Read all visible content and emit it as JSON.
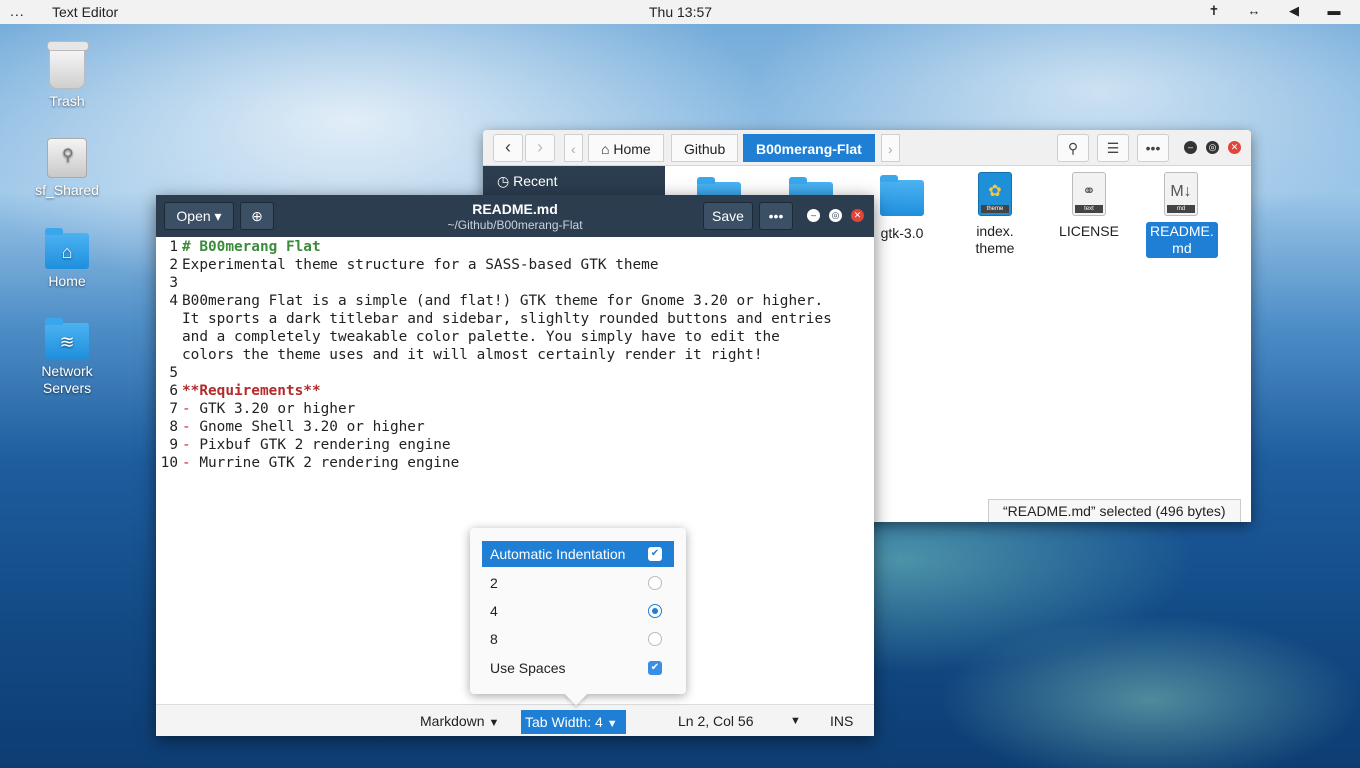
{
  "topbar": {
    "activities": "...",
    "app_name": "Text Editor",
    "clock": "Thu 13:57",
    "tray_icons": [
      "accessibility-icon",
      "network-icon",
      "volume-icon",
      "battery-icon"
    ]
  },
  "desktop": {
    "icons": [
      {
        "label": "Trash",
        "icon": "trash-icon"
      },
      {
        "label": "sf_Shared",
        "icon": "drive-icon"
      },
      {
        "label": "Home",
        "icon": "home-folder-icon"
      },
      {
        "label": "Network Servers",
        "icon": "network-folder-icon"
      }
    ]
  },
  "file_manager": {
    "breadcrumbs": [
      "Home",
      "Github",
      "B00merang-Flat"
    ],
    "active_crumb": "B00merang-Flat",
    "sidebar": {
      "recent": "Recent"
    },
    "files": [
      {
        "label": "gtk-3.0",
        "type": "folder"
      },
      {
        "label": "index.\ntheme",
        "type": "theme",
        "tag": "theme"
      },
      {
        "label": "LICENSE",
        "type": "text",
        "tag": "text"
      },
      {
        "label": "README.\nmd",
        "type": "markdown",
        "tag": "md",
        "selected": true
      }
    ],
    "status": "“README.md” selected  (496 bytes)"
  },
  "editor": {
    "open_label": "Open",
    "title": "README.md",
    "subtitle": "~/Github/B00merang-Flat",
    "save_label": "Save",
    "lines": [
      {
        "n": "1",
        "text": "# B00merang Flat"
      },
      {
        "n": "2",
        "text": "Experimental theme structure for a SASS-based GTK theme"
      },
      {
        "n": "3",
        "text": ""
      },
      {
        "n": "4",
        "text": "B00merang Flat is a simple (and flat!) GTK theme for Gnome 3.20 or higher."
      },
      {
        "n": "",
        "text": "It sports a dark titlebar and sidebar, slighlty rounded buttons and entries"
      },
      {
        "n": "",
        "text": "and a completely tweakable color palette. You simply have to edit the"
      },
      {
        "n": "",
        "text": "colors the theme uses and it will almost certainly render it right!"
      },
      {
        "n": "5",
        "text": ""
      },
      {
        "n": "6",
        "text": "**Requirements**"
      },
      {
        "n": "7",
        "text": "GTK 3.20 or higher"
      },
      {
        "n": "8",
        "text": "Gnome Shell 3.20 or higher"
      },
      {
        "n": "9",
        "text": "Pixbuf GTK 2 rendering engine"
      },
      {
        "n": "10",
        "text": "Murrine GTK 2 rendering engine"
      }
    ],
    "bullet": "-",
    "footer": {
      "language": "Markdown",
      "tab_width": "Tab Width: 4",
      "position": "Ln 2, Col 56",
      "mode": "INS"
    }
  },
  "popover": {
    "auto_indent": "Automatic Indentation",
    "options": [
      "2",
      "4",
      "8"
    ],
    "selected_option": "4",
    "use_spaces": "Use Spaces"
  }
}
